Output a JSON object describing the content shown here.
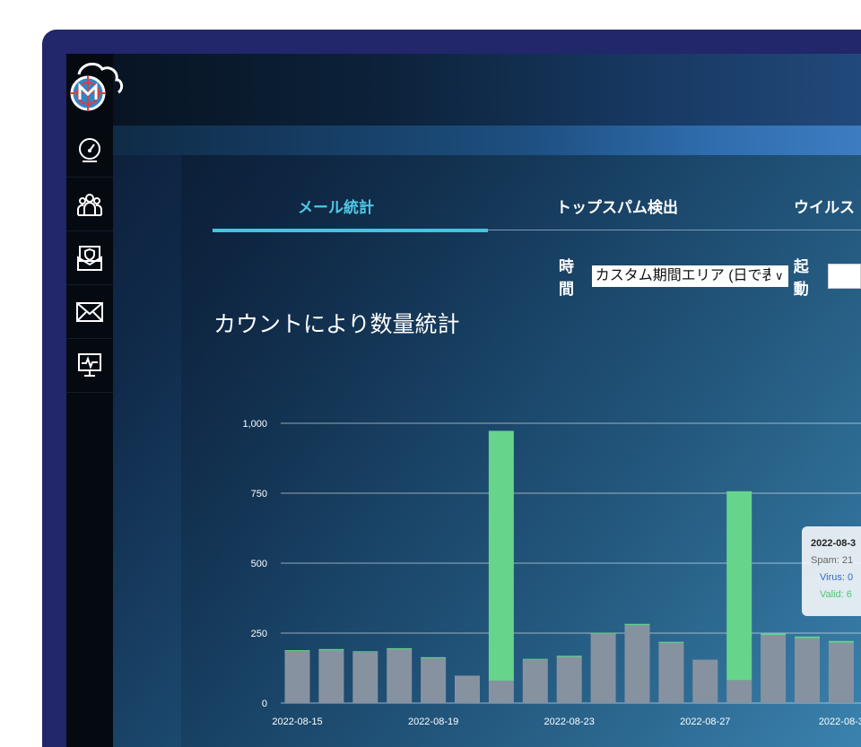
{
  "nav": {
    "items": [
      {
        "name": "dashboard",
        "icon": "gauge-icon"
      },
      {
        "name": "users",
        "icon": "users-icon"
      },
      {
        "name": "mail-security",
        "icon": "shield-mail-icon"
      },
      {
        "name": "mail",
        "icon": "envelope-icon"
      },
      {
        "name": "monitor",
        "icon": "monitor-pulse-icon"
      }
    ]
  },
  "tabs": [
    {
      "label": "メール統計",
      "active": true
    },
    {
      "label": "トップスパム検出",
      "active": false
    },
    {
      "label": "ウイルス",
      "active": false
    }
  ],
  "filters": {
    "time_label": "時間",
    "time_select_value": "カスタム期間エリア (日で表",
    "start_label": "起動"
  },
  "section_title": "カウントにより数量統計",
  "tooltip": {
    "date": "2022-08-3",
    "spam": "Spam: 21",
    "virus": "Virus: 0",
    "valid": "Valid: 6"
  },
  "chart_data": {
    "type": "bar",
    "stacked": true,
    "y_ticks": [
      "1,000",
      "750",
      "500",
      "250",
      "0"
    ],
    "ylim": [
      0,
      1000
    ],
    "x_tick_labels": [
      "2022-08-15",
      "2022-08-19",
      "2022-08-23",
      "2022-08-27",
      "2022-08-3"
    ],
    "categories": [
      "2022-08-15",
      "2022-08-16",
      "2022-08-17",
      "2022-08-18",
      "2022-08-19",
      "2022-08-20",
      "2022-08-21",
      "2022-08-22",
      "2022-08-23",
      "2022-08-24",
      "2022-08-25",
      "2022-08-26",
      "2022-08-27",
      "2022-08-28",
      "2022-08-29",
      "2022-08-30",
      "2022-08-31"
    ],
    "series": [
      {
        "name": "Spam",
        "color": "#8792a1",
        "values": [
          185,
          188,
          182,
          192,
          160,
          98,
          80,
          155,
          165,
          248,
          278,
          215,
          155,
          82,
          243,
          232,
          216
        ]
      },
      {
        "name": "Virus",
        "color": "#3a66c8",
        "values": [
          0,
          0,
          0,
          0,
          0,
          0,
          0,
          0,
          0,
          0,
          0,
          0,
          0,
          0,
          0,
          0,
          0
        ]
      },
      {
        "name": "Valid",
        "color": "#66d48a",
        "values": [
          4,
          5,
          3,
          4,
          4,
          0,
          893,
          3,
          4,
          3,
          5,
          4,
          0,
          675,
          5,
          6,
          6
        ]
      }
    ],
    "grid": true
  }
}
